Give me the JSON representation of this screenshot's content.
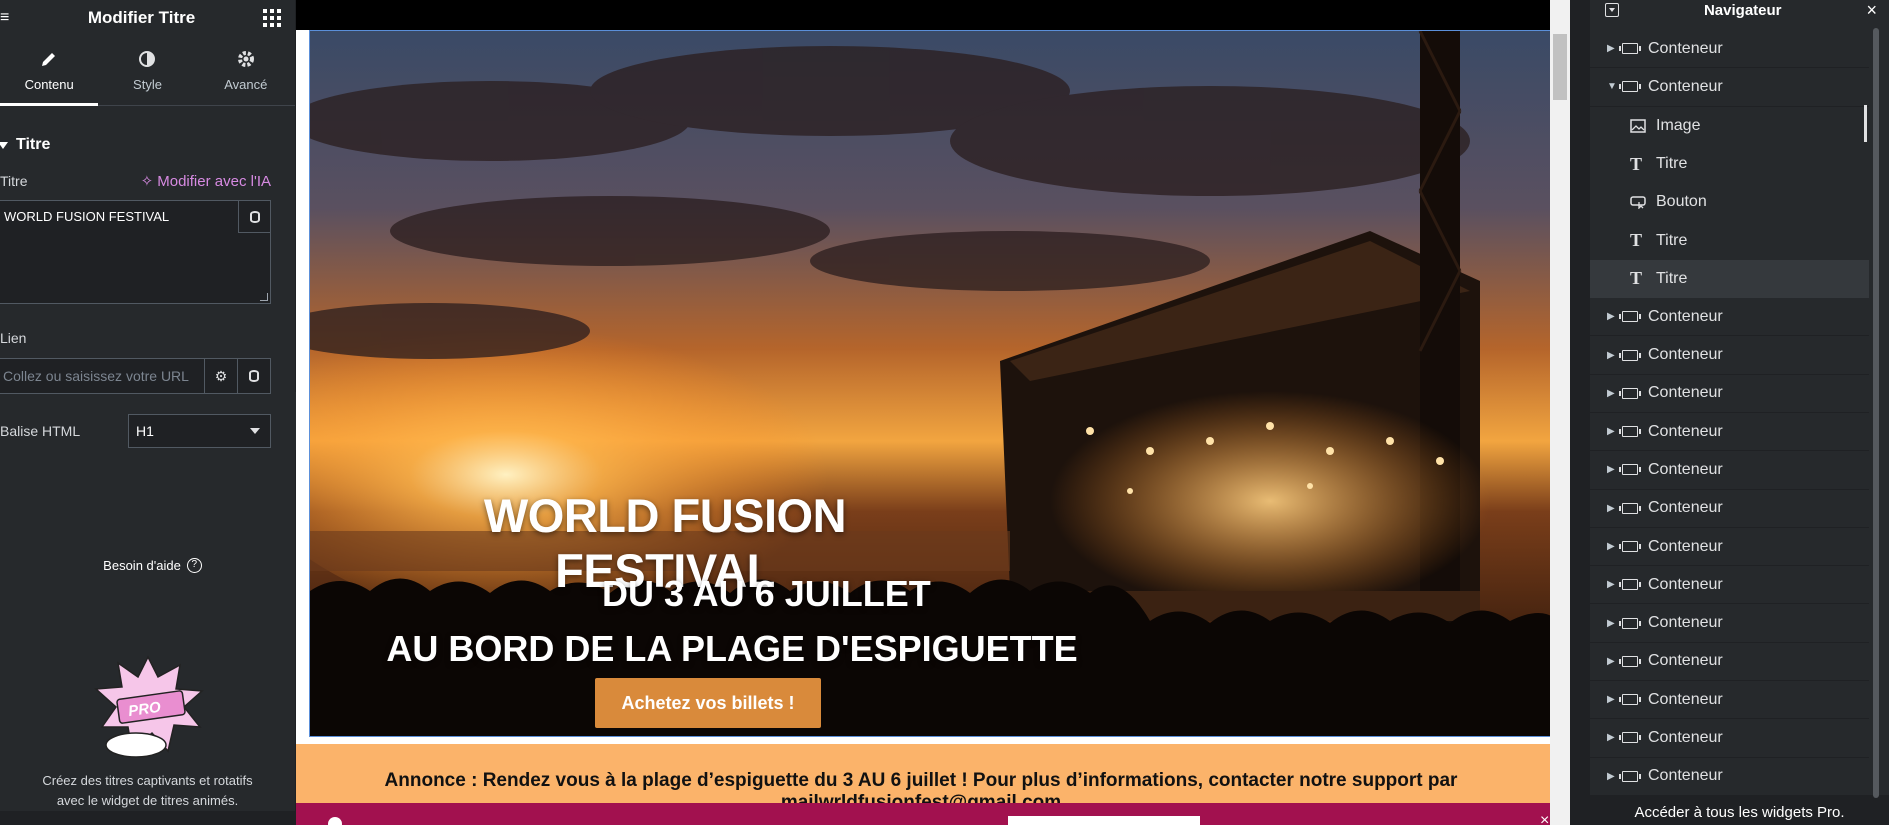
{
  "left_panel": {
    "title": "Modifier Titre",
    "tabs": [
      {
        "label": "Contenu",
        "icon": "pencil-icon"
      },
      {
        "label": "Style",
        "icon": "half-circle-icon"
      },
      {
        "label": "Avancé",
        "icon": "gear-icon"
      }
    ],
    "section_title": "Titre",
    "title_field_label": "Titre",
    "ai_link": "Modifier avec l'IA",
    "title_value": "WORLD FUSION FESTIVAL",
    "link_label": "Lien",
    "link_placeholder": "Collez ou saisissez votre URL",
    "html_tag_label": "Balise HTML",
    "html_tag_value": "H1",
    "help_label": "Besoin d'aide",
    "promo_line1": "Créez des titres captivants et rotatifs",
    "promo_line2": "avec le widget de titres animés.",
    "promo_badge": "PRO"
  },
  "canvas": {
    "hero_title": "WORLD FUSION FESTIVAL",
    "hero_line1": "DU 3 AU 6 JUILLET",
    "hero_line2": "AU BORD DE LA PLAGE D'ESPIGUETTE",
    "cta_label": "Achetez vos billets !",
    "announce_line1": "Annonce : Rendez vous à la plage d’espiguette du 3 AU 6 juillet ! Pour plus d’informations, contacter notre support par",
    "announce_line2": "mailwrldfusionfest@gmail.com",
    "accent_color": "#d98a3b",
    "announce_bg": "#fbb36a"
  },
  "navigator": {
    "title": "Navigateur",
    "items": [
      {
        "label": "Conteneur",
        "type": "container",
        "expanded": false
      },
      {
        "label": "Conteneur",
        "type": "container",
        "expanded": true
      },
      {
        "label": "Image",
        "type": "image",
        "child": true
      },
      {
        "label": "Titre",
        "type": "heading",
        "child": true
      },
      {
        "label": "Bouton",
        "type": "button",
        "child": true
      },
      {
        "label": "Titre",
        "type": "heading",
        "child": true
      },
      {
        "label": "Titre",
        "type": "heading",
        "child": true,
        "selected": true
      },
      {
        "label": "Conteneur",
        "type": "container"
      },
      {
        "label": "Conteneur",
        "type": "container"
      },
      {
        "label": "Conteneur",
        "type": "container"
      },
      {
        "label": "Conteneur",
        "type": "container"
      },
      {
        "label": "Conteneur",
        "type": "container"
      },
      {
        "label": "Conteneur",
        "type": "container"
      },
      {
        "label": "Conteneur",
        "type": "container"
      },
      {
        "label": "Conteneur",
        "type": "container"
      },
      {
        "label": "Conteneur",
        "type": "container"
      },
      {
        "label": "Conteneur",
        "type": "container"
      },
      {
        "label": "Conteneur",
        "type": "container"
      },
      {
        "label": "Conteneur",
        "type": "container"
      },
      {
        "label": "Conteneur",
        "type": "container"
      }
    ],
    "footer": "Accéder à tous les widgets Pro."
  }
}
